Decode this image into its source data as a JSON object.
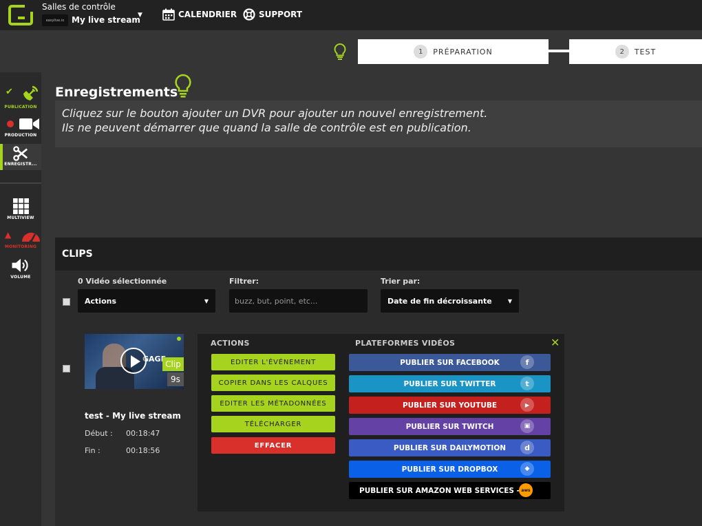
{
  "topbar": {
    "room_title": "Salles de contrôle",
    "room_logo_text": "easylive.io",
    "room_name": "My live stream",
    "nav": [
      {
        "label": "CALENDRIER",
        "icon": "calendar-icon"
      },
      {
        "label": "SUPPORT",
        "icon": "lifebuoy-icon"
      }
    ]
  },
  "steps": [
    {
      "num": "1",
      "label": "PRÉPARATION"
    },
    {
      "num": "2",
      "label": "TEST"
    }
  ],
  "sidebar": {
    "items": [
      {
        "label": "PUBLICATION",
        "icon": "satellite-icon",
        "status": "check",
        "color": "#a6d31e"
      },
      {
        "label": "PRODUCTION",
        "icon": "video-camera-icon",
        "status": "recording-dot",
        "color": "#ffffff"
      },
      {
        "label": "ENREGISTR...",
        "icon": "scissors-icon",
        "status": "active",
        "color": "#ffffff"
      },
      {
        "label": "MULTIVIEW",
        "icon": "grid-icon",
        "color": "#ffffff"
      },
      {
        "label": "MONITORING",
        "icon": "gauge-icon",
        "status": "warning",
        "color": "#d9302c"
      },
      {
        "label": "VOLUME",
        "icon": "speaker-icon",
        "color": "#ffffff"
      }
    ]
  },
  "recordings": {
    "title": "Enregistrements",
    "info_line1": "Cliquez sur le bouton ajouter un DVR pour ajouter un nouvel enregistrement.",
    "info_line2": "Ils ne peuvent démarrer que quand la salle de contrôle est en publication."
  },
  "clips": {
    "title": "CLIPS",
    "selected_count": "0",
    "selected_label": "Vidéo sélectionnée",
    "actions_select": "Actions",
    "filter_label": "Filtrer:",
    "filter_placeholder": "buzz, but, point, etc...",
    "sort_label": "Trier par:",
    "sort_value": "Date de fin décroissante",
    "items": [
      {
        "name": "test - My live stream",
        "start_label": "Début :",
        "start": "00:18:47",
        "end_label": "Fin :",
        "end": "00:18:56",
        "badge": "Clip",
        "duration": "9s",
        "thumb_text": "GAGE"
      }
    ],
    "actions_head": "ACTIONS",
    "platforms_head": "PLATEFORMES VIDÉOS",
    "actions": [
      "EDITER L'ÉVÉNEMENT",
      "COPIER DANS LES CALQUES",
      "EDITER LES MÉTADONNÉES",
      "TÉLÉCHARGER"
    ],
    "delete": "EFFACER",
    "platforms": [
      {
        "label": "PUBLIER SUR FACEBOOK",
        "color": "#3b5998",
        "icon": "facebook-icon",
        "glyph": "f"
      },
      {
        "label": "PUBLIER SUR TWITTER",
        "color": "#1a94c4",
        "icon": "twitter-icon",
        "glyph": "t"
      },
      {
        "label": "PUBLIER SUR YOUTUBE",
        "color": "#c4201e",
        "icon": "youtube-icon",
        "glyph": "▶"
      },
      {
        "label": "PUBLIER SUR TWITCH",
        "color": "#6441a4",
        "icon": "twitch-icon",
        "glyph": "▣"
      },
      {
        "label": "PUBLIER SUR DAILYMOTION",
        "color": "#3a5bc4",
        "icon": "dailymotion-icon",
        "glyph": "d"
      },
      {
        "label": "PUBLIER SUR DROPBOX",
        "color": "#0a61e8",
        "icon": "dropbox-icon",
        "glyph": "◆"
      },
      {
        "label": "PUBLIER SUR AMAZON WEB SERVICES -",
        "color": "#000000",
        "icon": "aws-icon",
        "glyph": "aws"
      }
    ]
  },
  "colors": {
    "accent": "#a6d31e",
    "danger": "#d9302c"
  }
}
